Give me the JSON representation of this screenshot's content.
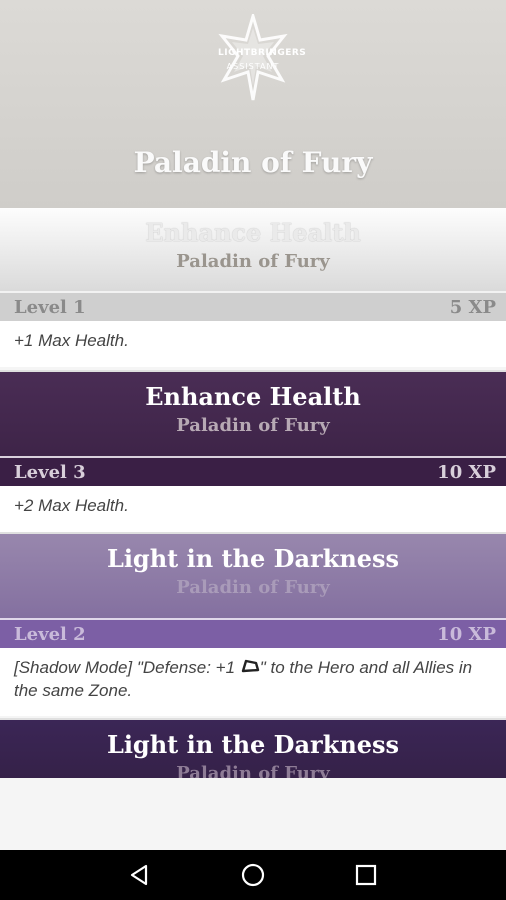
{
  "header": {
    "logo_line1": "LIGHTBRINGERS",
    "logo_line2": "ASSISTANT",
    "title": "Paladin of Fury"
  },
  "cards": [
    {
      "title": "Enhance Health",
      "subtitle": "Paladin of Fury",
      "level": "Level 1",
      "xp": "5 XP",
      "description": "+1 Max Health."
    },
    {
      "title": "Enhance Health",
      "subtitle": "Paladin of Fury",
      "level": "Level 3",
      "xp": "10 XP",
      "description": "+2 Max Health."
    },
    {
      "title": "Light in the Darkness",
      "subtitle": "Paladin of Fury",
      "level": "Level 2",
      "xp": "10 XP",
      "description_before": "[Shadow Mode] \"Defense: +1 ",
      "description_after": "\" to the Hero and all Allies in the same Zone."
    },
    {
      "title": "Light in the Darkness",
      "subtitle": "Paladin of Fury"
    }
  ],
  "navbar": {
    "back_icon": "back-triangle-icon",
    "home_icon": "home-circle-icon",
    "recents_icon": "recents-square-icon"
  },
  "colors": {
    "card1_header": "#e8e8e8",
    "card2_header": "#432850",
    "card3_header": "#8e7ba6",
    "card4_header": "#382350"
  }
}
